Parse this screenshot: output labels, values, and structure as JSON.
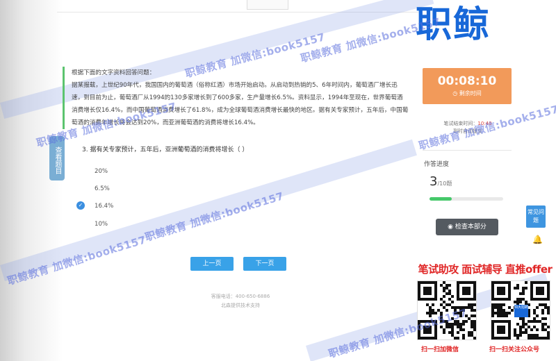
{
  "brand": {
    "logo_text": "职鲸"
  },
  "passage": {
    "title": "根据下面的文字资料回答问题：",
    "body": "据某报载，上世纪90年代，我国国内的葡萄酒（俗称红酒）市场开始启动。从启动到热销的5、6年时间内，葡萄酒厂增长迅速，到目前为止，葡萄酒厂从1994的130多家增长到了600多家，生产量增长6.5%。资料显示，1994年至现在，世界葡萄酒消费增长仅16.4%，而中国葡萄酒消费增长了61.8%，成为全球葡萄酒消费增长最快的地区。据有关专家预计，五年后，中国葡萄酒的消费年增长将会达到20%，而亚洲葡萄酒的消费将增长16.4%。"
  },
  "side_tab": {
    "label": "查看题目"
  },
  "question": {
    "number": "3.",
    "text": "据有关专家预计，五年后，亚洲葡萄酒的消费将增长（   ）",
    "options": [
      "20%",
      "6.5%",
      "16.4%",
      "10%"
    ],
    "selected_index": 2
  },
  "nav": {
    "prev": "上一页",
    "next": "下一页"
  },
  "footer": {
    "hotline": "客服电话：400-650-6886",
    "support": "北森提供技术支持"
  },
  "timer": {
    "time": "00:08:10",
    "label": "剩余时间"
  },
  "end_time": {
    "label": "笔试结束时间：",
    "value": "10:40",
    "note": "到时自动提交"
  },
  "progress": {
    "title": "作答进度",
    "answered": "3",
    "total": "/10题",
    "fraction": 0.3
  },
  "check_button": {
    "label": "检查本部分"
  },
  "faq": {
    "label": "常见问题"
  },
  "promo": {
    "headline": "笔试助攻  面试辅导  直推offer"
  },
  "qr": {
    "left_label": "扫一扫加微信",
    "right_label": "扫一扫关注公众号",
    "right_badge": "四大招聘"
  },
  "watermark": {
    "text": "职鲸教育 加微信:book5157"
  },
  "colors": {
    "accent_blue": "#39a2e8",
    "timer_orange": "#f29a5a",
    "brand_blue": "#1868d8",
    "promo_red": "#e02626",
    "progress_green": "#45c86a"
  },
  "icons": {
    "selected": "check-circle-icon",
    "timer": "clock-icon",
    "check": "eye-icon",
    "bell": "bell-icon"
  }
}
